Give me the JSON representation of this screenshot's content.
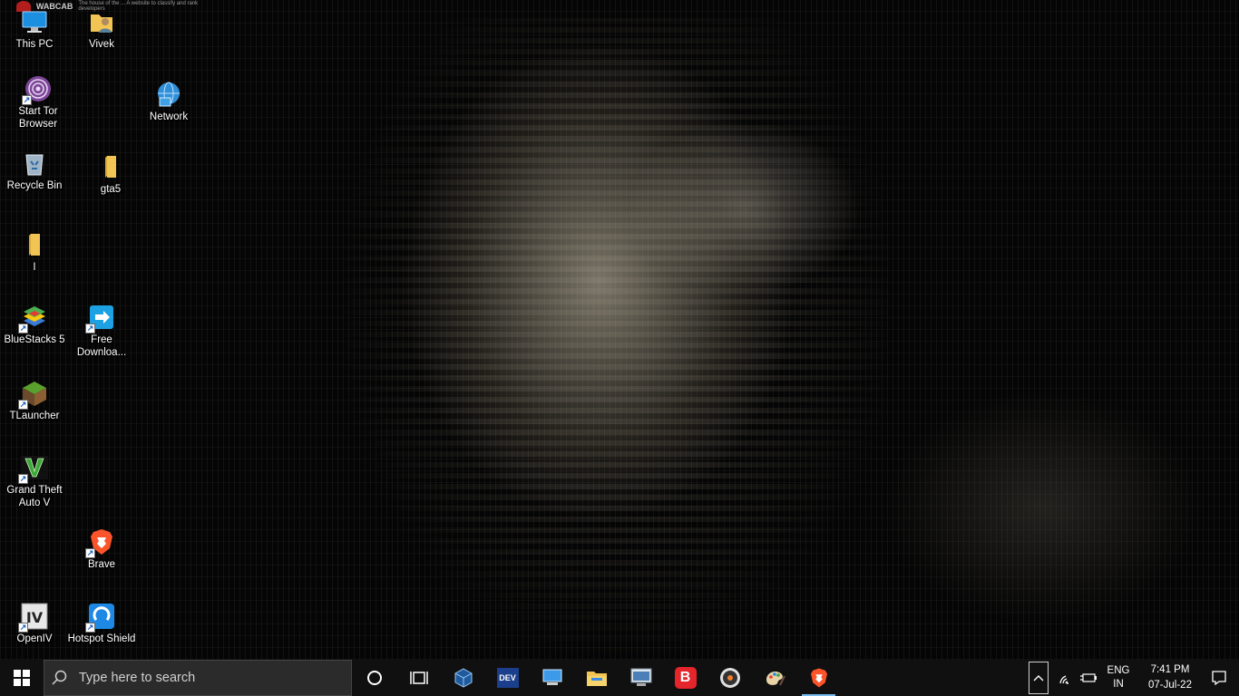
{
  "desktop": {
    "watermark": {
      "name": "WABCAB",
      "tagline": "The house of the ... A website to classify and rank developers"
    },
    "icons": [
      {
        "label": "This PC",
        "icon": "this-pc-icon",
        "shortcut": false
      },
      {
        "label": "Vivek",
        "icon": "user-folder-icon",
        "shortcut": false
      },
      {
        "label": "Start Tor Browser",
        "icon": "tor-browser-icon",
        "shortcut": true
      },
      {
        "label": "Network",
        "icon": "network-icon",
        "shortcut": false
      },
      {
        "label": "Recycle Bin",
        "icon": "recycle-bin-icon",
        "shortcut": false
      },
      {
        "label": "gta5",
        "icon": "folder-icon",
        "shortcut": false
      },
      {
        "label": "I",
        "icon": "folder-icon",
        "shortcut": false
      },
      {
        "label": "BlueStacks 5",
        "icon": "bluestacks-icon",
        "shortcut": true
      },
      {
        "label": "Free Downloa...",
        "icon": "free-download-manager-icon",
        "shortcut": true
      },
      {
        "label": "TLauncher",
        "icon": "tlauncher-icon",
        "shortcut": true
      },
      {
        "label": "Grand Theft Auto V",
        "icon": "gta-v-icon",
        "shortcut": true
      },
      {
        "label": "Brave",
        "icon": "brave-icon",
        "shortcut": true
      },
      {
        "label": "OpenIV",
        "icon": "openiv-icon",
        "shortcut": true
      },
      {
        "label": "Hotspot Shield",
        "icon": "hotspot-shield-icon",
        "shortcut": true
      }
    ]
  },
  "taskbar": {
    "search_placeholder": "Type here to search",
    "apps": [
      {
        "name": "cortana",
        "icon": "cortana-icon"
      },
      {
        "name": "task-view",
        "icon": "task-view-icon"
      },
      {
        "name": "virtualbox",
        "icon": "virtualbox-icon"
      },
      {
        "name": "devcpp",
        "icon": "dev-cpp-icon",
        "text": "DEV"
      },
      {
        "name": "this-pc",
        "icon": "computer-icon"
      },
      {
        "name": "file-explorer",
        "icon": "file-explorer-icon"
      },
      {
        "name": "remote-desktop",
        "icon": "remote-desktop-icon"
      },
      {
        "name": "bandicam",
        "icon": "bandicam-icon",
        "text": "B"
      },
      {
        "name": "media-player",
        "icon": "media-player-icon"
      },
      {
        "name": "paint",
        "icon": "paint-icon"
      },
      {
        "name": "brave",
        "icon": "brave-icon",
        "active": true
      }
    ],
    "tray": {
      "language_line1": "ENG",
      "language_line2": "IN",
      "time": "7:41 PM",
      "date": "07-Jul-22"
    }
  },
  "colors": {
    "taskbar": "#101010",
    "search_box": "#2b2b2b",
    "active_indicator": "#76b9ed",
    "brave": "#fb542b",
    "tor": "#7d4698"
  }
}
